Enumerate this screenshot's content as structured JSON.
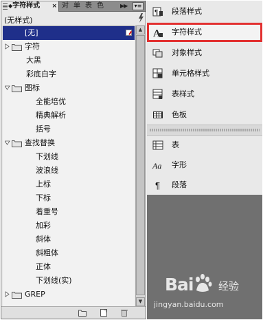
{
  "panel": {
    "tabs": [
      {
        "label": "字符样式",
        "active": true
      },
      {
        "label": "对"
      },
      {
        "label": "单"
      },
      {
        "label": "表"
      },
      {
        "label": "色"
      }
    ],
    "forward_glyph": "▶▶",
    "menu_glyph": "▾≡",
    "current_style": "(无样式)",
    "tree": [
      {
        "label": "[无]",
        "selected": true,
        "level": 0,
        "folder": false
      },
      {
        "label": "字符",
        "level": 0,
        "folder": true,
        "expanded": false
      },
      {
        "label": "大黑",
        "level": 1,
        "folder": false
      },
      {
        "label": "彩底白字",
        "level": 1,
        "folder": false
      },
      {
        "label": "图标",
        "level": 0,
        "folder": true,
        "expanded": true
      },
      {
        "label": "全能培优",
        "level": 2,
        "folder": false
      },
      {
        "label": "精典解析",
        "level": 2,
        "folder": false
      },
      {
        "label": "括号",
        "level": 2,
        "folder": false
      },
      {
        "label": "查找替换",
        "level": 0,
        "folder": true,
        "expanded": true
      },
      {
        "label": "下划线",
        "level": 2,
        "folder": false
      },
      {
        "label": "波浪线",
        "level": 2,
        "folder": false
      },
      {
        "label": "上标",
        "level": 2,
        "folder": false
      },
      {
        "label": "下标",
        "level": 2,
        "folder": false
      },
      {
        "label": "着重号",
        "level": 2,
        "folder": false
      },
      {
        "label": "加彩",
        "level": 2,
        "folder": false
      },
      {
        "label": "斜体",
        "level": 2,
        "folder": false
      },
      {
        "label": "斜粗体",
        "level": 2,
        "folder": false
      },
      {
        "label": "正体",
        "level": 2,
        "folder": false
      },
      {
        "label": "下划线(实)",
        "level": 2,
        "folder": false
      },
      {
        "label": "GREP",
        "level": 0,
        "folder": true,
        "expanded": false
      }
    ]
  },
  "menu": {
    "items_top": [
      {
        "label": "段落样式",
        "icon": "paragraph-style-icon"
      },
      {
        "label": "字符样式",
        "icon": "character-style-icon",
        "highlighted": true
      },
      {
        "label": "对象样式",
        "icon": "object-style-icon"
      },
      {
        "label": "单元格样式",
        "icon": "cell-style-icon"
      },
      {
        "label": "表样式",
        "icon": "table-style-icon"
      },
      {
        "label": "色板",
        "icon": "swatches-icon"
      }
    ],
    "items_bottom": [
      {
        "label": "表",
        "icon": "table-icon"
      },
      {
        "label": "字形",
        "icon": "glyphs-icon",
        "icon_text": "Aa"
      },
      {
        "label": "段落",
        "icon": "paragraph-icon",
        "icon_text": "¶"
      }
    ]
  },
  "watermark": {
    "brand": "Bai",
    "brand_tail": "经验",
    "url": "jingyan.baidu.com"
  },
  "colors": {
    "selection": "#1f2f8a",
    "highlight_border": "#e23030",
    "panel_bg": "#e9e9e9",
    "dark_bg": "#707070"
  }
}
